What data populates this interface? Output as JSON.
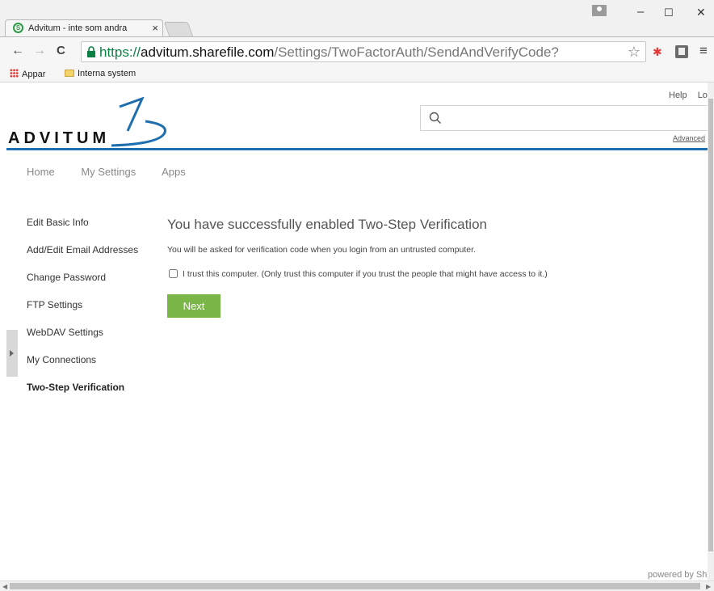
{
  "browser": {
    "tab_title": "Advitum - inte som andra",
    "tab_close": "×",
    "url_scheme": "https://",
    "url_host": "advitum.sharefile.com",
    "url_path": "/Settings/TwoFactorAuth/SendAndVerifyCode?",
    "window_controls": {
      "minimize": "–",
      "maximize": "☐",
      "close": "✕"
    },
    "nav": {
      "back": "←",
      "forward": "→",
      "reload": "C"
    },
    "star": "☆",
    "menu": "≡"
  },
  "bookmarks": {
    "apps": "Appar",
    "folder": "Interna system"
  },
  "header": {
    "help": "Help",
    "logout": "Lo",
    "logo_text": "ADVITUM",
    "search_placeholder": "",
    "advanced": "Advanced"
  },
  "topnav": [
    "Home",
    "My Settings",
    "Apps"
  ],
  "sidebar": {
    "items": [
      {
        "label": "Edit Basic Info"
      },
      {
        "label": "Add/Edit Email Addresses"
      },
      {
        "label": "Change Password"
      },
      {
        "label": "FTP Settings"
      },
      {
        "label": "WebDAV Settings"
      },
      {
        "label": "My Connections"
      },
      {
        "label": "Two-Step Verification"
      }
    ]
  },
  "main": {
    "heading": "You have successfully enabled Two-Step Verification",
    "subtext": "You will be asked for verification code when you login from an untrusted computer.",
    "trust_label": "I trust this computer. (Only trust this computer if you trust the people that might have access to it.)",
    "next_label": "Next"
  },
  "footer": {
    "powered": "powered by Sh"
  },
  "colors": {
    "brand_blue": "#1f6eae",
    "button_green": "#7ab648"
  }
}
